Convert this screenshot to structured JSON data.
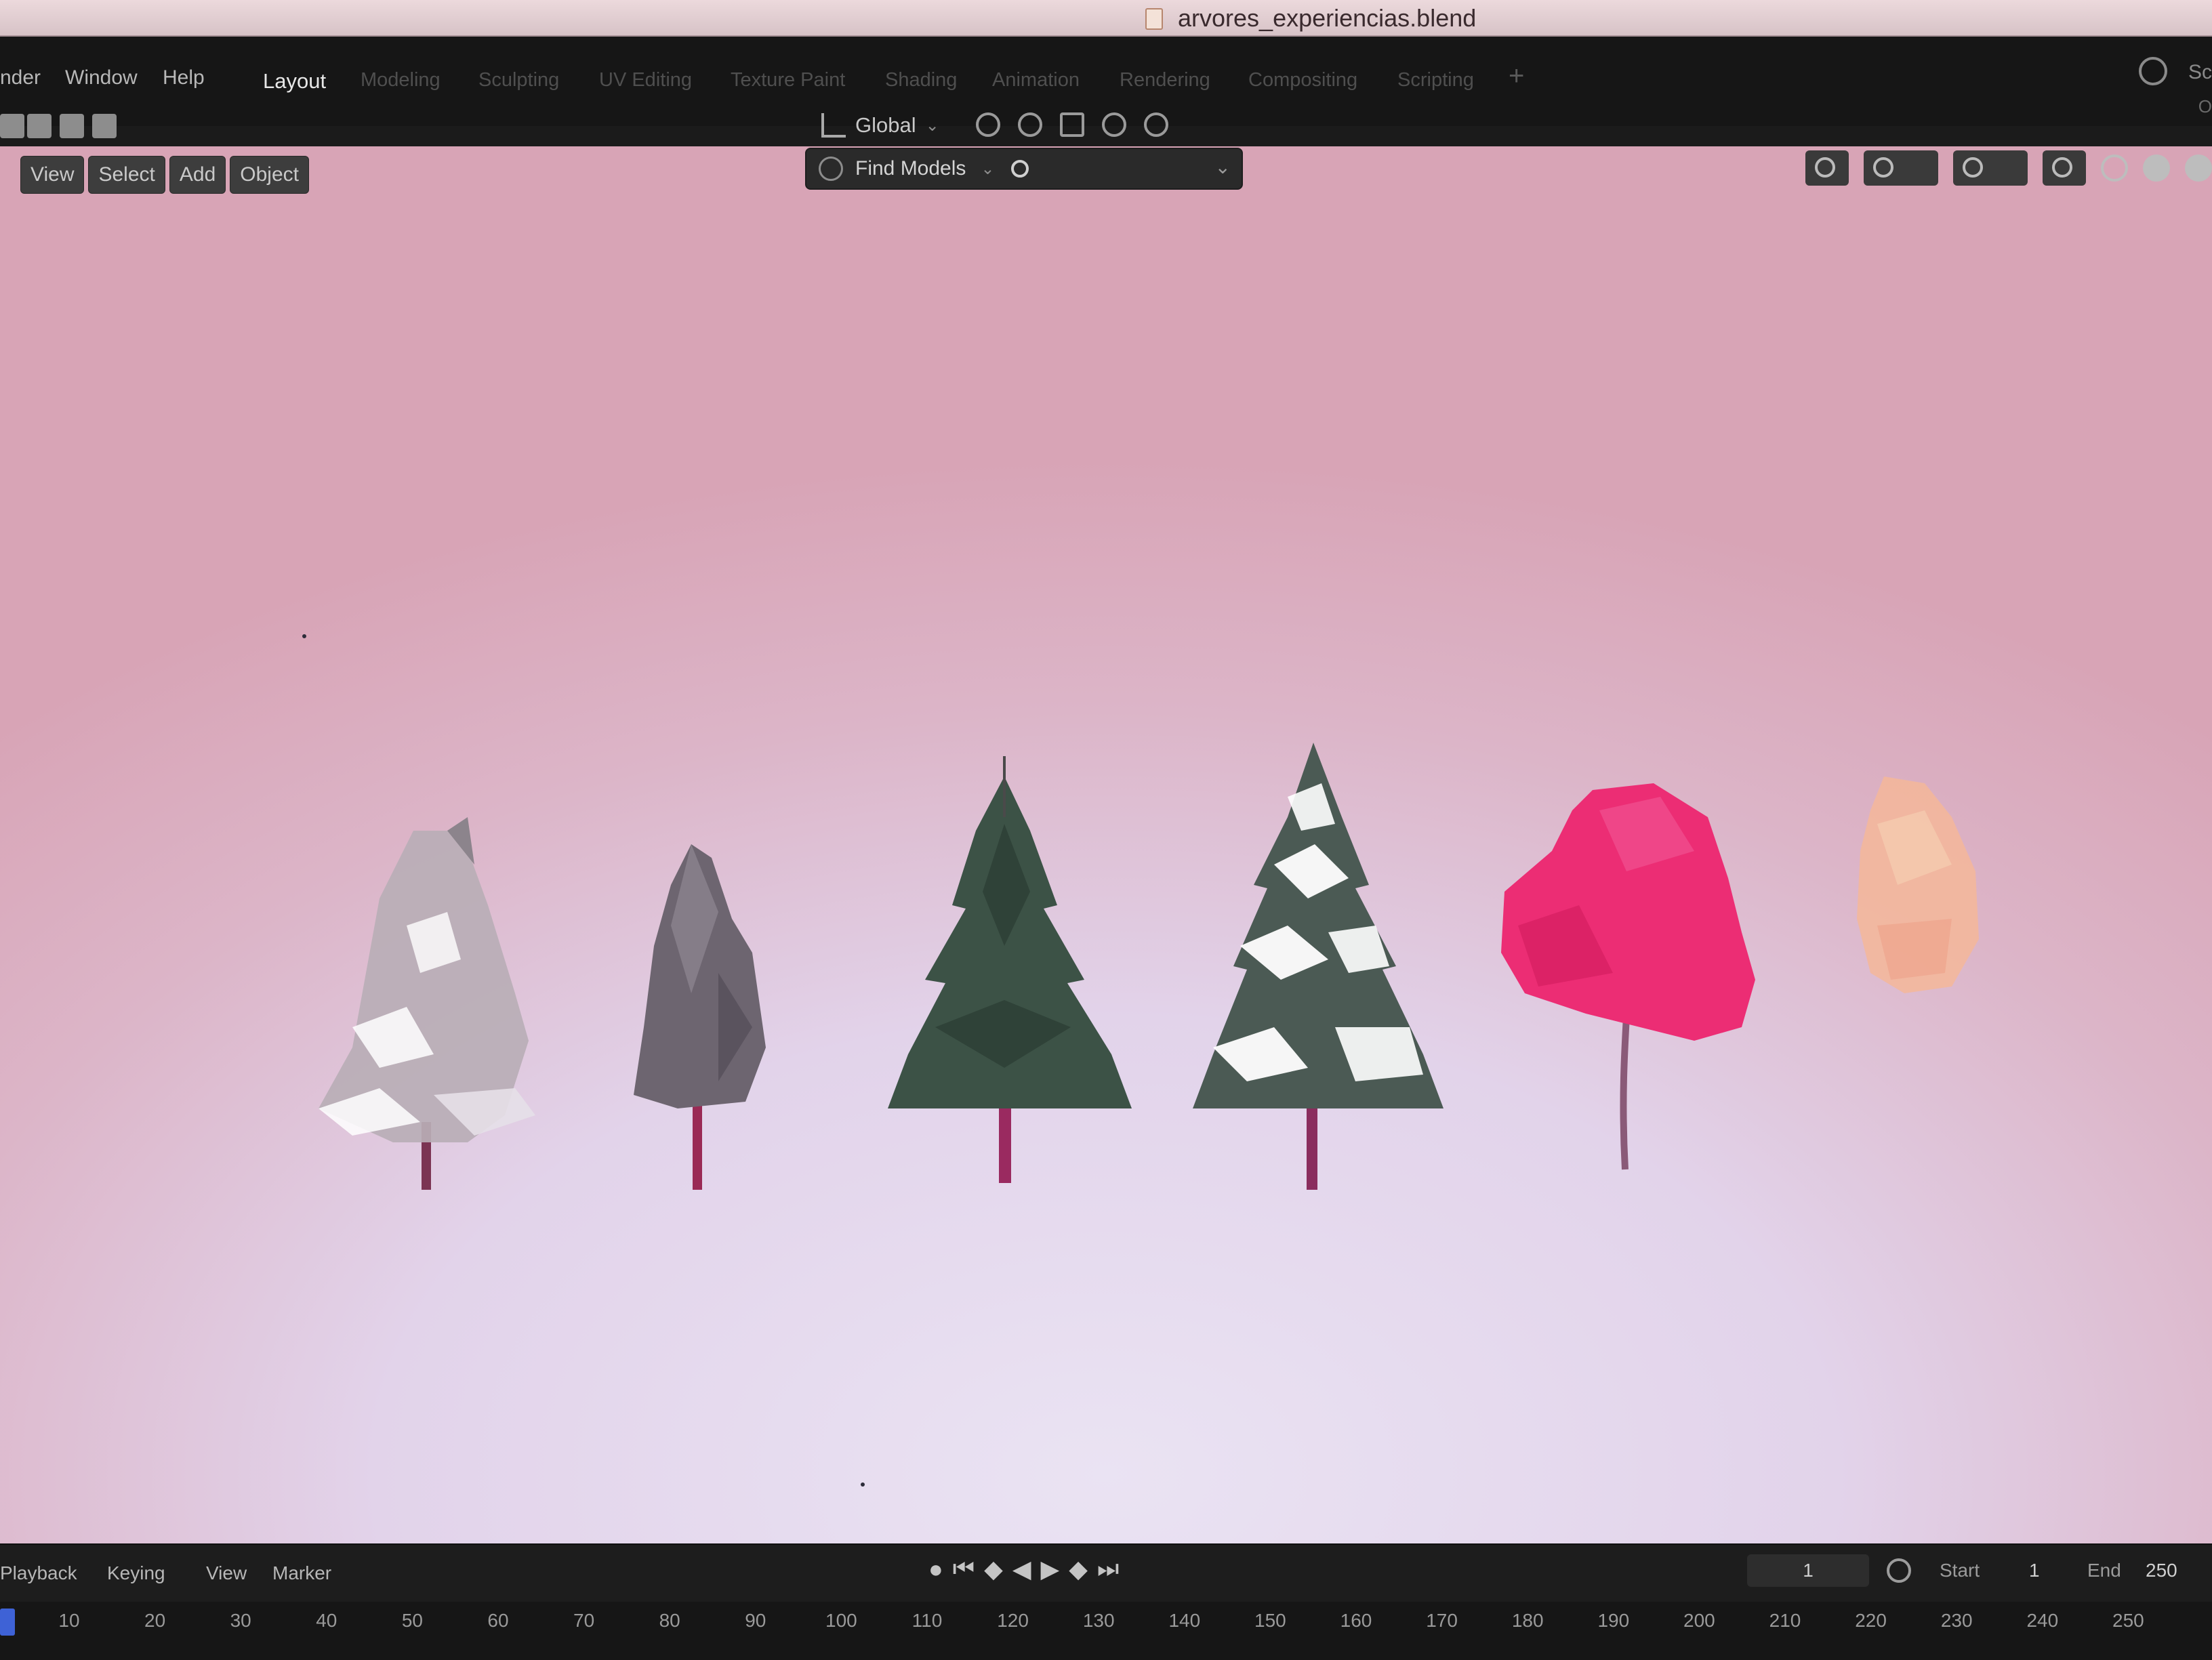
{
  "window": {
    "title": "arvores_experiencias.blend"
  },
  "menus": [
    "nder",
    "Window",
    "Help"
  ],
  "workspace_tabs": [
    {
      "label": "Layout",
      "active": true
    },
    {
      "label": "Modeling",
      "active": false
    },
    {
      "label": "Sculpting",
      "active": false
    },
    {
      "label": "UV Editing",
      "active": false
    },
    {
      "label": "Texture Paint",
      "active": false
    },
    {
      "label": "Shading",
      "active": false
    },
    {
      "label": "Animation",
      "active": false
    },
    {
      "label": "Rendering",
      "active": false
    },
    {
      "label": "Compositing",
      "active": false
    },
    {
      "label": "Scripting",
      "active": false
    }
  ],
  "add_workspace_label": "+",
  "top_right": {
    "scene_label": "Sc",
    "corner_label": "O"
  },
  "header": {
    "orientation_label": "Global",
    "find_models_label": "Find Models"
  },
  "viewport_menu": [
    "View",
    "Select",
    "Add",
    "Object"
  ],
  "viewport": {
    "background_top": "#d8a4b6",
    "background_bottom": "#eae3f3",
    "objects": [
      {
        "name": "tree-1",
        "color": "#b8aeb6"
      },
      {
        "name": "tree-2",
        "color": "#6d6570"
      },
      {
        "name": "tree-3",
        "color": "#3c5246"
      },
      {
        "name": "tree-4",
        "color": "#4b5a54"
      },
      {
        "name": "tree-5",
        "color": "#ec2d74"
      },
      {
        "name": "tree-6",
        "color": "#f5b89a"
      }
    ]
  },
  "timeline": {
    "menus": [
      "Playback",
      "Keying",
      "View",
      "Marker"
    ],
    "current_frame": "1",
    "start_label": "Start",
    "start_value": "1",
    "end_label": "End",
    "end_value": "250",
    "ticks": [
      "10",
      "20",
      "30",
      "40",
      "50",
      "60",
      "70",
      "80",
      "90",
      "100",
      "110",
      "120",
      "130",
      "140",
      "150",
      "160",
      "170",
      "180",
      "190",
      "200",
      "210",
      "220",
      "230",
      "240",
      "250"
    ]
  }
}
